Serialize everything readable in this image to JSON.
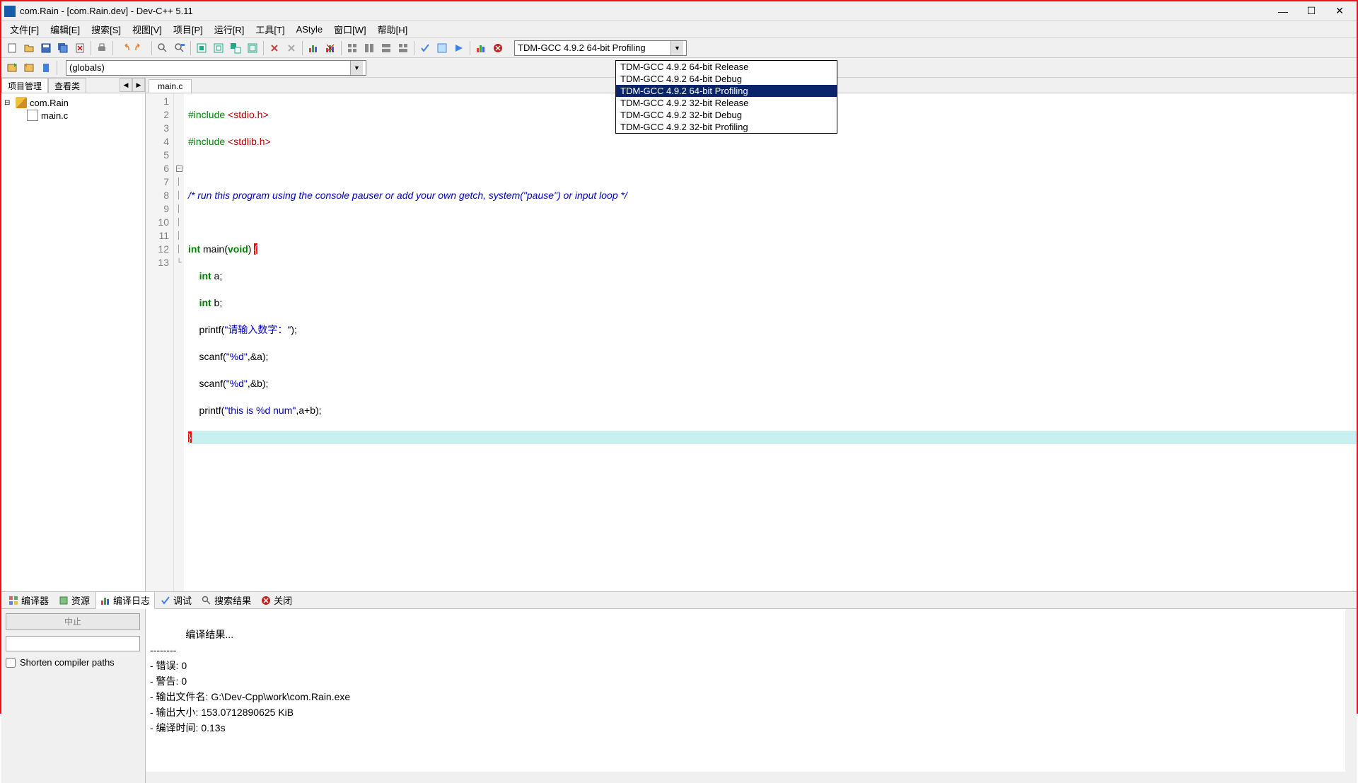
{
  "title": "com.Rain - [com.Rain.dev] - Dev-C++ 5.11",
  "menu": [
    "文件[F]",
    "编辑[E]",
    "搜索[S]",
    "视图[V]",
    "项目[P]",
    "运行[R]",
    "工具[T]",
    "AStyle",
    "窗口[W]",
    "帮助[H]"
  ],
  "compiler": {
    "selected": "TDM-GCC 4.9.2 64-bit Profiling",
    "options": [
      "TDM-GCC 4.9.2 64-bit Release",
      "TDM-GCC 4.9.2 64-bit Debug",
      "TDM-GCC 4.9.2 64-bit Profiling",
      "TDM-GCC 4.9.2 32-bit Release",
      "TDM-GCC 4.9.2 32-bit Debug",
      "TDM-GCC 4.9.2 32-bit Profiling"
    ],
    "highlighted_index": 2
  },
  "scope": "(globals)",
  "left_tabs": [
    "项目管理",
    "查看类"
  ],
  "project": {
    "name": "com.Rain",
    "files": [
      "main.c"
    ]
  },
  "editor_tab": "main.c",
  "lines": [
    "1",
    "2",
    "3",
    "4",
    "5",
    "6",
    "7",
    "8",
    "9",
    "10",
    "11",
    "12",
    "13"
  ],
  "code": {
    "l1": {
      "pre": "#include ",
      "inc": "<stdio.h>"
    },
    "l2": {
      "pre": "#include ",
      "inc": "<stdlib.h>"
    },
    "l4": "/* run this program using the console pauser or add your own getch, system(\"pause\") or input loop */",
    "l6": {
      "a": "int",
      "b": " main(",
      "c": "void",
      "d": ") ",
      "e": "{"
    },
    "l7": {
      "a": "    ",
      "b": "int",
      "c": " a;"
    },
    "l8": {
      "a": "    ",
      "b": "int",
      "c": " b;"
    },
    "l9": {
      "a": "    printf(",
      "b": "\"请输入数字：\"",
      "c": ");"
    },
    "l10": {
      "a": "    scanf(",
      "b": "\"%d\"",
      "c": ",&a);"
    },
    "l11": {
      "a": "    scanf(",
      "b": "\"%d\"",
      "c": ",&b);"
    },
    "l12": {
      "a": "    printf(",
      "b": "\"this is %d num\"",
      "c": ",a+b);"
    },
    "l13": "}"
  },
  "bottom_tabs": [
    "编译器",
    "资源",
    "编译日志",
    "调试",
    "搜索结果",
    "关闭"
  ],
  "stop": "中止",
  "shorten": "Shorten compiler paths",
  "output": "编译结果...\n--------\n- 错误: 0\n- 警告: 0\n- 输出文件名: G:\\Dev-Cpp\\work\\com.Rain.exe\n- 输出大小: 153.0712890625 KiB\n- 编译时间: 0.13s"
}
